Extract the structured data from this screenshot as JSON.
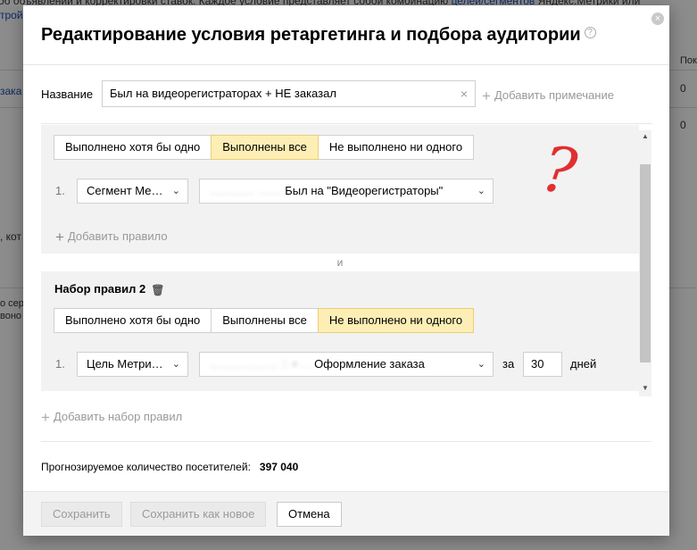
{
  "background": {
    "top_text_a": "об объявлений и корректировки ставок. Каждое условие представляет собой комбинацию ",
    "top_text_link": "целей/сегментов",
    "top_text_b": " Яндекс.Метрики или",
    "link_stroy": "тройк",
    "link_zaka": "зака",
    "col_header": "Пок",
    "row_value_1": "0",
    "row_value_2": "0",
    "text_kot": ", кот",
    "text_ser": "о сер",
    "text_vono": "воно"
  },
  "modal": {
    "title": "Редактирование условия ретаргетинга и подбора аудитории",
    "help_icon": "?",
    "close_icon": "×",
    "name_label": "Название",
    "name_value": "Был на видеорегистраторах + НЕ заказал",
    "clear_icon": "×",
    "add_note_plus": "+",
    "add_note_label": "Добавить примечание",
    "and_label": "и",
    "add_ruleset_plus": "+",
    "add_ruleset_label": "Добавить набор правил",
    "forecast_label": "Прогнозируемое количество посетителей:",
    "forecast_value": "397 040",
    "annotation": "?"
  },
  "ruleset1": {
    "options": [
      "Выполнено хотя бы одно",
      "Выполнены все",
      "Не выполнено ни одного"
    ],
    "active_index": 1,
    "rule_num": "1.",
    "type_select": "Сегмент Ме…",
    "value_blurred": "………… ……",
    "value_text": "Был на \"Видеорегистраторы\"",
    "add_rule_plus": "+",
    "add_rule_label": "Добавить правило"
  },
  "ruleset2": {
    "title": "Набор правил 2",
    "trash_icon": "🗑",
    "options": [
      "Выполнено хотя бы одно",
      "Выполнены все",
      "Не выполнено ни одного"
    ],
    "active_index": 2,
    "rule_num": "1.",
    "type_select": "Цель Метри…",
    "value_blurred": "……………… :: + . .",
    "value_text": "Оформление заказа",
    "za_label": "за",
    "days_value": "30",
    "days_label": "дней"
  },
  "chevron": "⌄",
  "scroll_up": "▲",
  "scroll_down": "▼",
  "footer": {
    "save": "Сохранить",
    "save_as_new": "Сохранить как новое",
    "cancel": "Отмена"
  },
  "colors": {
    "active_segment": "#fdeeb5",
    "ruleset_bg": "#f2f2f2",
    "annotation": "#e03030"
  }
}
